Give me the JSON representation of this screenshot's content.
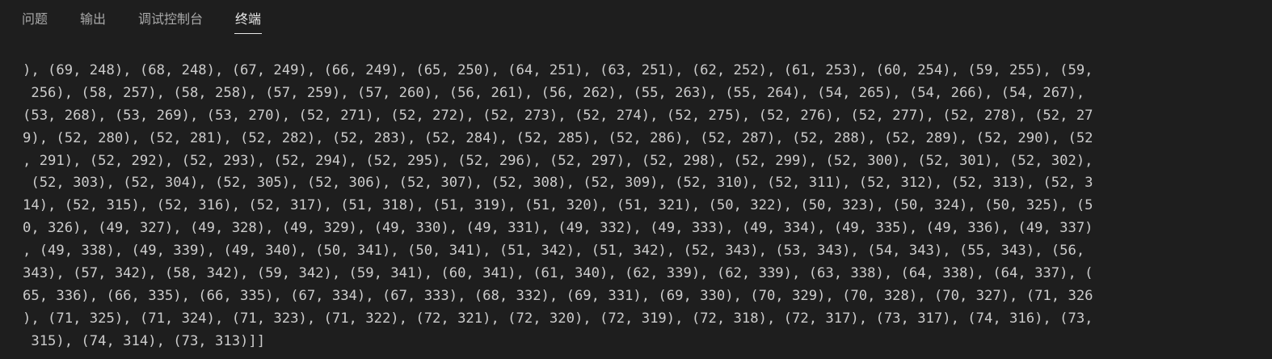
{
  "panel": {
    "tabs": [
      {
        "label": "问题",
        "active": false
      },
      {
        "label": "输出",
        "active": false
      },
      {
        "label": "调试控制台",
        "active": false
      },
      {
        "label": "终端",
        "active": true
      }
    ]
  },
  "terminal": {
    "lines": [
      "), (69, 248), (68, 248), (67, 249), (66, 249), (65, 250), (64, 251), (63, 251), (62, 252), (61, 253), (60, 254), (59, 255), (59,",
      " 256), (58, 257), (58, 258), (57, 259), (57, 260), (56, 261), (56, 262), (55, 263), (55, 264), (54, 265), (54, 266), (54, 267),",
      "(53, 268), (53, 269), (53, 270), (52, 271), (52, 272), (52, 273), (52, 274), (52, 275), (52, 276), (52, 277), (52, 278), (52, 27",
      "9), (52, 280), (52, 281), (52, 282), (52, 283), (52, 284), (52, 285), (52, 286), (52, 287), (52, 288), (52, 289), (52, 290), (52",
      ", 291), (52, 292), (52, 293), (52, 294), (52, 295), (52, 296), (52, 297), (52, 298), (52, 299), (52, 300), (52, 301), (52, 302),",
      " (52, 303), (52, 304), (52, 305), (52, 306), (52, 307), (52, 308), (52, 309), (52, 310), (52, 311), (52, 312), (52, 313), (52, 3",
      "14), (52, 315), (52, 316), (52, 317), (51, 318), (51, 319), (51, 320), (51, 321), (50, 322), (50, 323), (50, 324), (50, 325), (5",
      "0, 326), (49, 327), (49, 328), (49, 329), (49, 330), (49, 331), (49, 332), (49, 333), (49, 334), (49, 335), (49, 336), (49, 337)",
      ", (49, 338), (49, 339), (49, 340), (50, 341), (50, 341), (51, 342), (51, 342), (52, 343), (53, 343), (54, 343), (55, 343), (56,",
      "343), (57, 342), (58, 342), (59, 342), (59, 341), (60, 341), (61, 340), (62, 339), (62, 339), (63, 338), (64, 338), (64, 337), (",
      "65, 336), (66, 335), (66, 335), (67, 334), (67, 333), (68, 332), (69, 331), (69, 330), (70, 329), (70, 328), (70, 327), (71, 326",
      "), (71, 325), (71, 324), (71, 323), (71, 322), (72, 321), (72, 320), (72, 319), (72, 318), (72, 317), (73, 317), (74, 316), (73,",
      " 315), (74, 314), (73, 313)]]"
    ]
  },
  "colors": {
    "background": "#1e1e1e",
    "tab_inactive": "#a9a9a9",
    "tab_active": "#e7e7e7",
    "terminal_text": "#cccccc"
  }
}
